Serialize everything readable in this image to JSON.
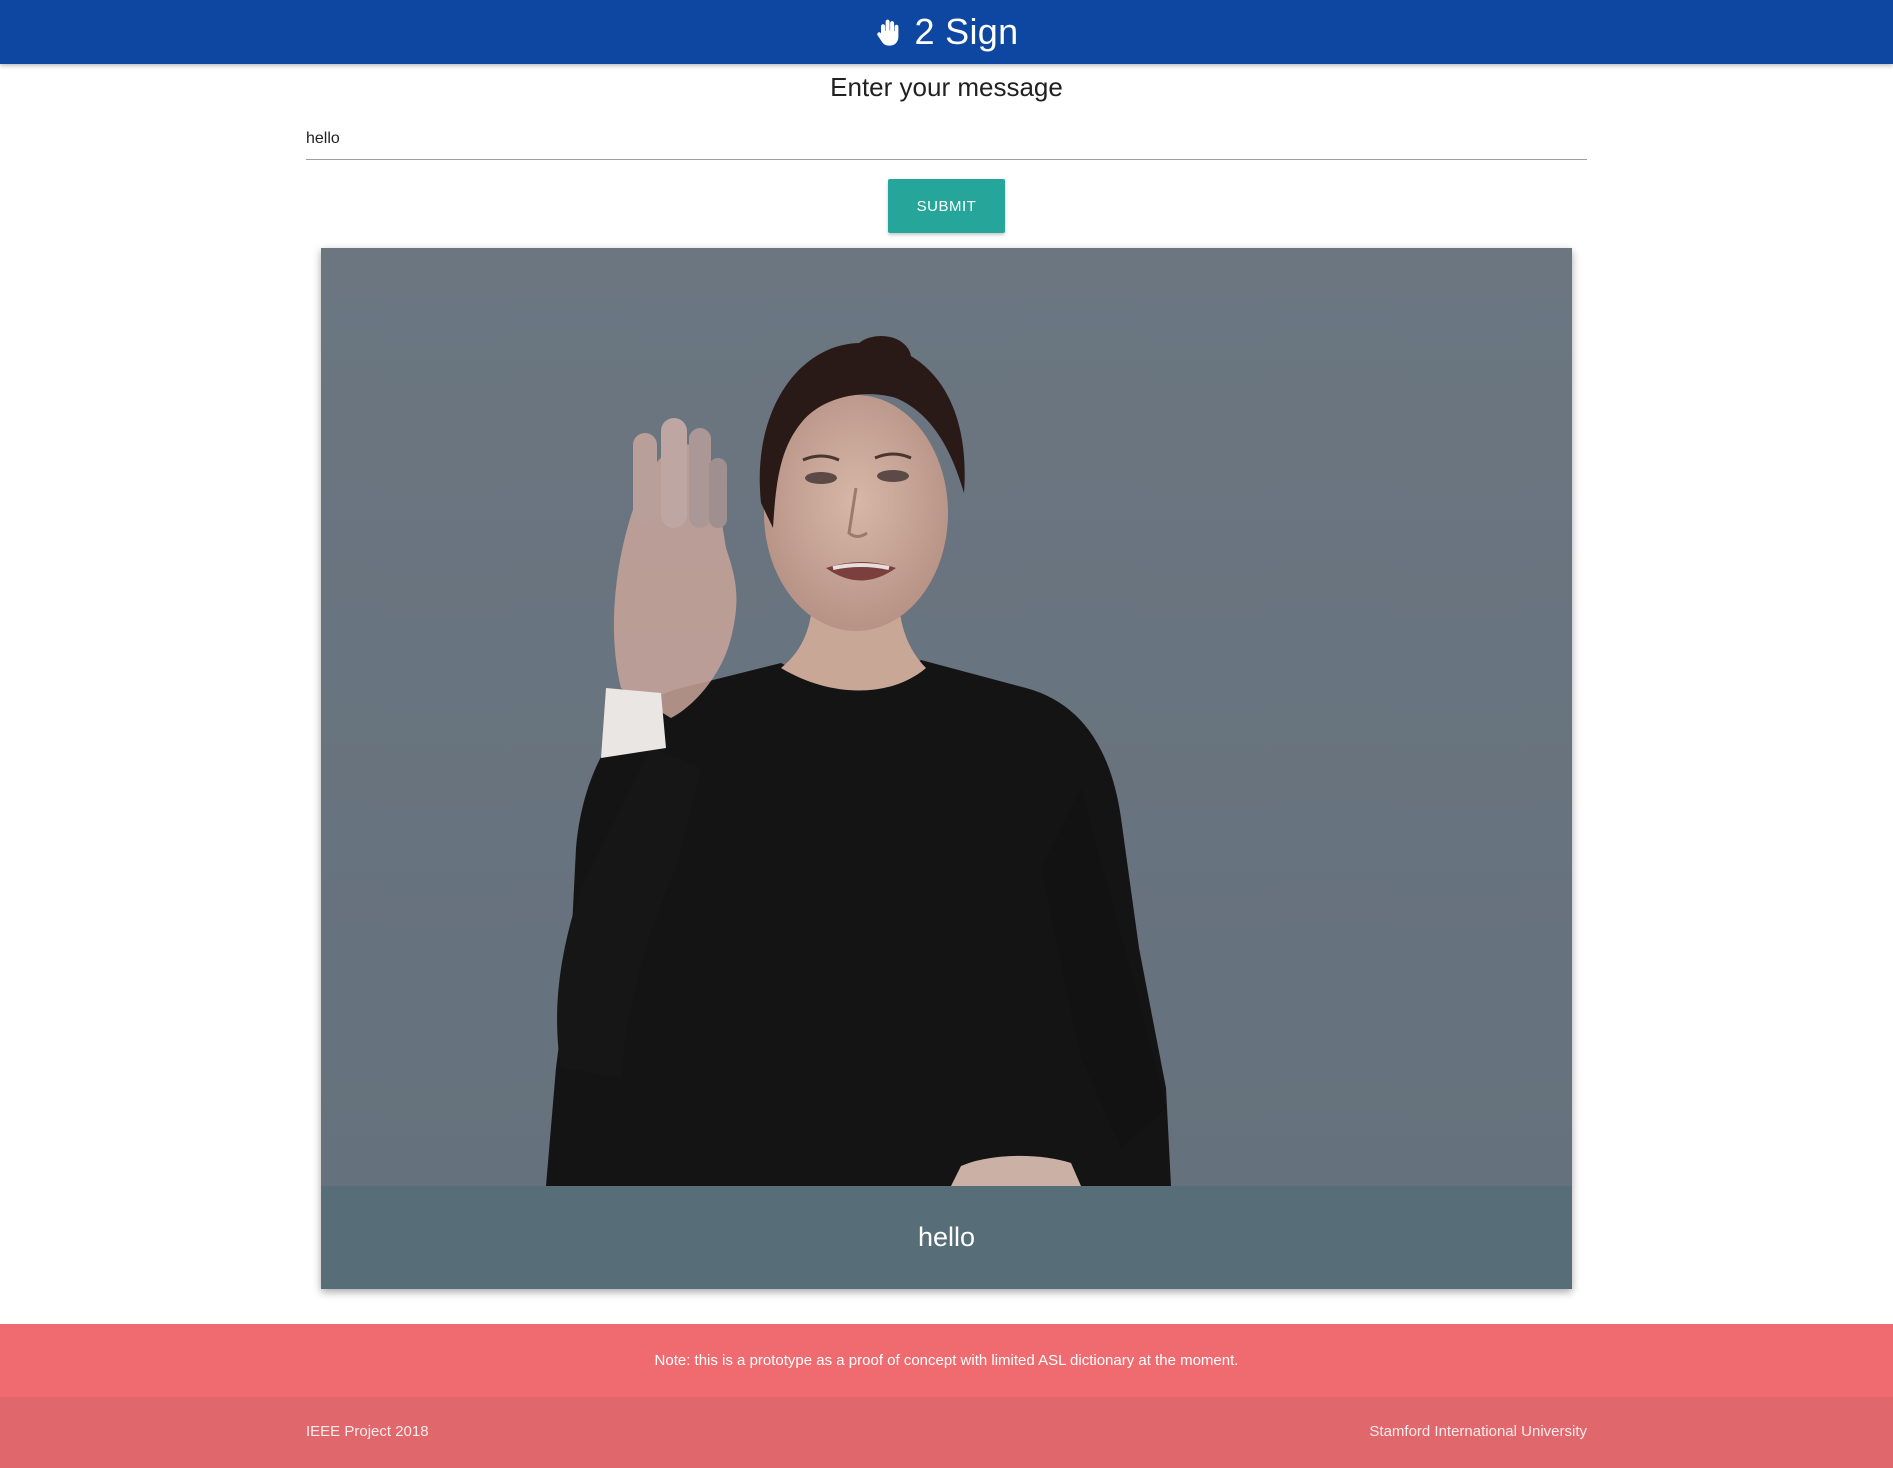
{
  "header": {
    "icon": "hand-paper-icon",
    "title": "2 Sign",
    "color": "#0d47a1"
  },
  "main": {
    "title": "Enter your message",
    "message_value": "hello",
    "submit_label": "SUBMIT",
    "submit_color": "#26a69a"
  },
  "card": {
    "image": "person-signing-hello",
    "caption": "hello",
    "caption_color": "#546e7a"
  },
  "footer": {
    "note": "Note: this is a prototype as a proof of concept with limited ASL dictionary at the moment.",
    "left_text": "IEEE Project 2018",
    "right_text": "Stamford International University",
    "color": "#ef6b70"
  }
}
